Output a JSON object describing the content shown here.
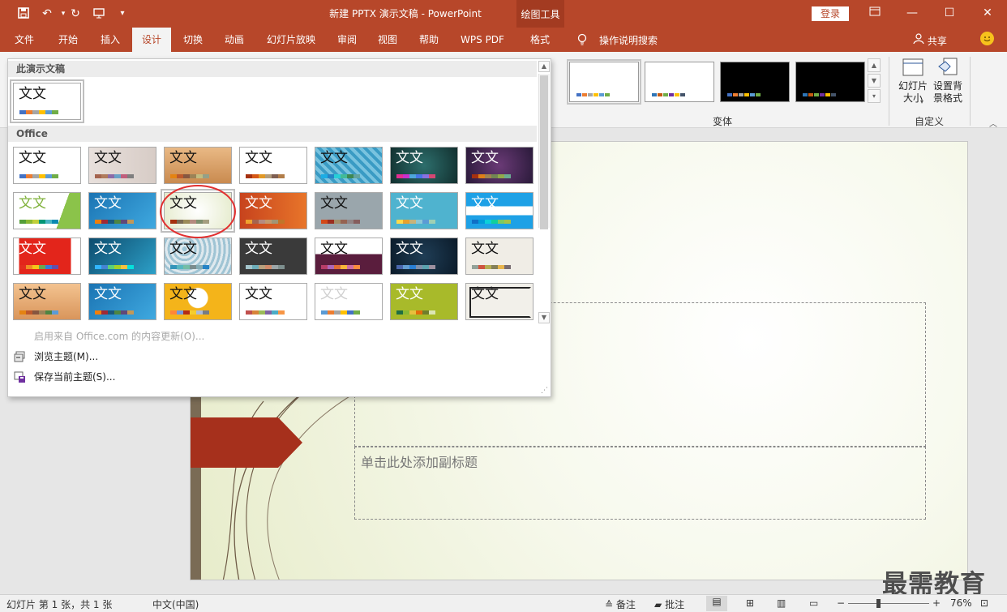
{
  "window": {
    "title": "新建 PPTX 演示文稿  -  PowerPoint",
    "context_tab_group": "绘图工具",
    "login_label": "登录",
    "quick_access_icons": [
      "save-icon",
      "undo-icon",
      "redo-icon",
      "present-icon",
      "customize-icon"
    ]
  },
  "tabs": [
    {
      "label": "文件"
    },
    {
      "label": "开始"
    },
    {
      "label": "插入"
    },
    {
      "label": "设计",
      "active": true
    },
    {
      "label": "切换"
    },
    {
      "label": "动画"
    },
    {
      "label": "幻灯片放映"
    },
    {
      "label": "审阅"
    },
    {
      "label": "视图"
    },
    {
      "label": "帮助"
    },
    {
      "label": "WPS PDF"
    },
    {
      "label": "格式"
    }
  ],
  "tell_me": "操作说明搜索",
  "share_label": "共享",
  "ribbon": {
    "variants_label": "变体",
    "customize_label": "自定义",
    "slide_size": {
      "line1": "幻灯片",
      "line2": "大小"
    },
    "format_background": {
      "line1": "设置背",
      "line2": "景格式"
    }
  },
  "gallery": {
    "section_this": "此演示文稿",
    "section_office": "Office",
    "thumb_text": "文文",
    "menu": {
      "enable_updates": "启用来自 Office.com 的内容更新(O)...",
      "browse_themes": "浏览主题(M)...",
      "save_theme": "保存当前主题(S)..."
    }
  },
  "slide": {
    "subtitle_placeholder": "单击此处添加副标题"
  },
  "status": {
    "slide_counter": "幻灯片 第 1 张，共 1 张",
    "language": "中文(中国)",
    "notes_label": "备注",
    "comments_label": "批注",
    "zoom": "76%"
  },
  "watermark": "最需教育",
  "colors": {
    "accent": "#b7472a",
    "annotation": "#e23030"
  }
}
